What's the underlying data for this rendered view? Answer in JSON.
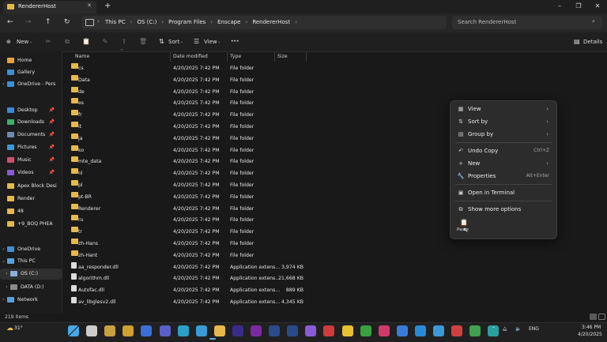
{
  "window": {
    "tab_title": "RendererHost",
    "new_tab": "+",
    "controls": {
      "minimize": "–",
      "maximize": "❐",
      "close": "✕"
    }
  },
  "address": {
    "crumbs": [
      "This PC",
      "OS (C:)",
      "Program Files",
      "Enscape",
      "RendererHost"
    ],
    "search_placeholder": "Search RendererHost"
  },
  "commands": {
    "new": "New",
    "sort": "Sort",
    "view": "View",
    "more": "···",
    "details": "Details"
  },
  "sidebar": [
    {
      "label": "Home",
      "color": "#e8a33a"
    },
    {
      "label": "Gallery",
      "color": "#3d8fd6"
    },
    {
      "label": "OneDrive - Pers",
      "color": "#3d8fd6",
      "chevron": "›"
    },
    {
      "label": "Desktop",
      "color": "#3a8ad8",
      "pin": "📌"
    },
    {
      "label": "Downloads",
      "color": "#3fae6a",
      "pin": "📌"
    },
    {
      "label": "Documents",
      "color": "#6f89b0",
      "pin": "📌"
    },
    {
      "label": "Pictures",
      "color": "#3a9ad8",
      "pin": "📌"
    },
    {
      "label": "Music",
      "color": "#d0506a",
      "pin": "📌"
    },
    {
      "label": "Videos",
      "color": "#8a5ad8",
      "pin": "📌"
    },
    {
      "label": "Apex Block Desi",
      "color": "#e8b84a"
    },
    {
      "label": "Render",
      "color": "#e8b84a"
    },
    {
      "label": "48",
      "color": "#e8b84a"
    },
    {
      "label": "+9_BOQ PHEA",
      "color": "#e8b84a"
    },
    {
      "label": "OneDrive",
      "color": "#3d8fd6",
      "chevron": "›"
    },
    {
      "label": "This PC",
      "color": "#5aa0d8",
      "chevron": "⌄"
    },
    {
      "label": "OS (C:)",
      "color": "#8ab0d8",
      "chevron": "›"
    },
    {
      "label": "DATA (D:)",
      "color": "#8a8a8a",
      "chevron": "›"
    },
    {
      "label": "Network",
      "color": "#5aa0d8",
      "chevron": "›"
    }
  ],
  "columns": {
    "name": "Name",
    "date": "Date modified",
    "type": "Type",
    "size": "Size"
  },
  "files": [
    {
      "name": "cs",
      "date": "4/20/2025 7:42 PM",
      "type": "File folder",
      "size": "",
      "kind": "folder"
    },
    {
      "name": "Data",
      "date": "4/20/2025 7:42 PM",
      "type": "File folder",
      "size": "",
      "kind": "folder"
    },
    {
      "name": "de",
      "date": "4/20/2025 7:42 PM",
      "type": "File folder",
      "size": "",
      "kind": "folder"
    },
    {
      "name": "es",
      "date": "4/20/2025 7:42 PM",
      "type": "File folder",
      "size": "",
      "kind": "folder"
    },
    {
      "name": "fr",
      "date": "4/20/2025 7:42 PM",
      "type": "File folder",
      "size": "",
      "kind": "folder"
    },
    {
      "name": "it",
      "date": "4/20/2025 7:42 PM",
      "type": "File folder",
      "size": "",
      "kind": "folder"
    },
    {
      "name": "ja",
      "date": "4/20/2025 7:42 PM",
      "type": "File folder",
      "size": "",
      "kind": "folder"
    },
    {
      "name": "ko",
      "date": "4/20/2025 7:42 PM",
      "type": "File folder",
      "size": "",
      "kind": "folder"
    },
    {
      "name": "mte_data",
      "date": "4/20/2025 7:42 PM",
      "type": "File folder",
      "size": "",
      "kind": "folder"
    },
    {
      "name": "nl",
      "date": "4/20/2025 7:42 PM",
      "type": "File folder",
      "size": "",
      "kind": "folder"
    },
    {
      "name": "pl",
      "date": "4/20/2025 7:42 PM",
      "type": "File folder",
      "size": "",
      "kind": "folder"
    },
    {
      "name": "pt-BR",
      "date": "4/20/2025 7:42 PM",
      "type": "File folder",
      "size": "",
      "kind": "folder"
    },
    {
      "name": "Renderer",
      "date": "4/20/2025 7:42 PM",
      "type": "File folder",
      "size": "",
      "kind": "folder"
    },
    {
      "name": "ru",
      "date": "4/20/2025 7:42 PM",
      "type": "File folder",
      "size": "",
      "kind": "folder"
    },
    {
      "name": "tr",
      "date": "4/20/2025 7:42 PM",
      "type": "File folder",
      "size": "",
      "kind": "folder"
    },
    {
      "name": "zh-Hans",
      "date": "4/20/2025 7:42 PM",
      "type": "File folder",
      "size": "",
      "kind": "folder"
    },
    {
      "name": "zh-Hant",
      "date": "4/20/2025 7:42 PM",
      "type": "File folder",
      "size": "",
      "kind": "folder"
    },
    {
      "name": "aa_responder.dll",
      "date": "4/20/2025 7:42 PM",
      "type": "Application extens...",
      "size": "3,974 KB",
      "kind": "file"
    },
    {
      "name": "algorithm.dll",
      "date": "4/20/2025 7:42 PM",
      "type": "Application extens...",
      "size": "21,668 KB",
      "kind": "file"
    },
    {
      "name": "Autofac.dll",
      "date": "4/20/2025 7:42 PM",
      "type": "Application extens...",
      "size": "889 KB",
      "kind": "file"
    },
    {
      "name": "av_libglesv2.dll",
      "date": "4/20/2025 7:42 PM",
      "type": "Application extens...",
      "size": "4,345 KB",
      "kind": "file"
    }
  ],
  "context_menu": {
    "items": [
      {
        "icon": "▦",
        "label": "View",
        "arrow": "›"
      },
      {
        "icon": "⇅",
        "label": "Sort by",
        "arrow": "›"
      },
      {
        "icon": "▤",
        "label": "Group by",
        "arrow": "›"
      },
      {
        "sep": true
      },
      {
        "icon": "↶",
        "label": "Undo Copy",
        "shortcut": "Ctrl+Z"
      },
      {
        "icon": "+",
        "label": "New",
        "arrow": "›"
      },
      {
        "icon": "🔧",
        "label": "Properties",
        "shortcut": "Alt+Enter"
      },
      {
        "sep": true
      },
      {
        "icon": "▣",
        "label": "Open in Terminal"
      },
      {
        "sep": true
      },
      {
        "icon": "⧉",
        "label": "Show more options"
      }
    ],
    "paste_label": "Paste"
  },
  "status": {
    "count": "219 items"
  },
  "taskbar": {
    "weather_temp": "31°",
    "tray_lang": "ENG",
    "time": "3:46 PM",
    "date": "4/20/2025",
    "icon_colors": [
      "#3a9ad8",
      "#cccccc",
      "#c8a040",
      "#d0a030",
      "#3a70d8",
      "#5a60c8",
      "#2aa0c8",
      "#3a9ad8",
      "#e8b84a",
      "#3a2a8a",
      "#7a2aa0",
      "#2a4a8a",
      "#2a4a8a",
      "#8a5ad8",
      "#d03a3a",
      "#e8c030",
      "#3aa040",
      "#d03a6a",
      "#3a7ad8",
      "#2a8ad8",
      "#3a9ad8",
      "#d04040",
      "#40a050",
      "#2aa0a0"
    ]
  }
}
